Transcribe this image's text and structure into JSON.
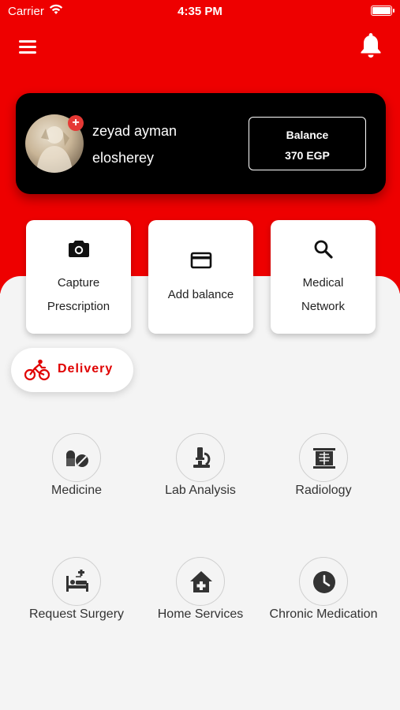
{
  "status_bar": {
    "carrier": "Carrier",
    "time": "4:35 PM"
  },
  "header": {
    "menu_icon": "hamburger-menu-icon",
    "notification_icon": "bell-icon"
  },
  "profile": {
    "name": "zeyad ayman",
    "username": "elosherey",
    "balance_label": "Balance",
    "balance_value": "370 EGP",
    "add_badge": "+"
  },
  "actions": [
    {
      "label_line1": "Capture",
      "label_line2": "Prescription",
      "icon": "camera-icon"
    },
    {
      "label_line1": "Add balance",
      "label_line2": "",
      "icon": "credit-card-icon"
    },
    {
      "label_line1": "Medical",
      "label_line2": "Network",
      "icon": "search-icon"
    }
  ],
  "delivery": {
    "label": "Delivery",
    "icon": "bicycle-rider-icon"
  },
  "services": [
    {
      "label": "Medicine",
      "icon": "pills-icon"
    },
    {
      "label": "Lab Analysis",
      "icon": "microscope-icon"
    },
    {
      "label": "Radiology",
      "icon": "xray-icon"
    },
    {
      "label": "Request Surgery",
      "icon": "hospital-bed-icon"
    },
    {
      "label": "Home Services",
      "icon": "home-plus-icon"
    },
    {
      "label": "Chronic Medication",
      "icon": "clock-icon"
    }
  ],
  "colors": {
    "primary": "#ee0000",
    "card_dark": "#000000",
    "background": "#f4f4f4",
    "icon_dark": "#333333"
  }
}
